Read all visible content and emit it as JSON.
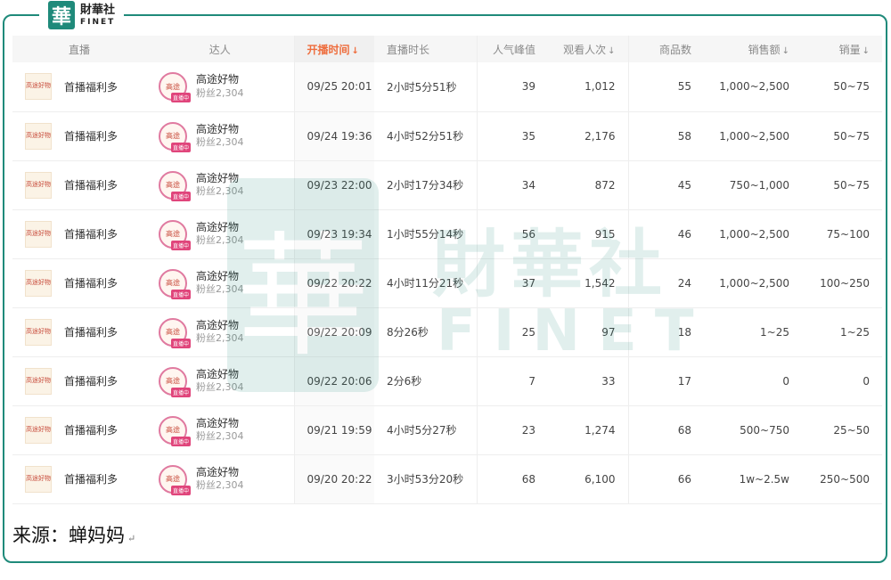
{
  "logo": {
    "mark": "華",
    "cn": "財華社",
    "en": "FINET"
  },
  "watermark": {
    "mark": "華",
    "cn": "財華社",
    "en": "FINET"
  },
  "table": {
    "headers": {
      "live": "直播",
      "talent": "达人",
      "start_time": "开播时间",
      "duration": "直播时长",
      "peak_popularity": "人气峰值",
      "views": "观看人次",
      "products": "商品数",
      "sales_amount": "销售额",
      "sales_volume": "销量"
    },
    "sort_arrow": "↓",
    "rows": [
      {
        "thumb": "高途好物",
        "title": "首播福利多",
        "avatar": "高途",
        "badge": "直播中",
        "name": "高途好物",
        "fans": "粉丝2,304",
        "start_time": "09/25 20:01",
        "duration": "2小时5分51秒",
        "peak": "39",
        "views": "1,012",
        "products": "55",
        "amount": "1,000~2,500",
        "volume": "50~75"
      },
      {
        "thumb": "高途好物",
        "title": "首播福利多",
        "avatar": "高途",
        "badge": "直播中",
        "name": "高途好物",
        "fans": "粉丝2,304",
        "start_time": "09/24 19:36",
        "duration": "4小时52分51秒",
        "peak": "35",
        "views": "2,176",
        "products": "58",
        "amount": "1,000~2,500",
        "volume": "50~75"
      },
      {
        "thumb": "高途好物",
        "title": "首播福利多",
        "avatar": "高途",
        "badge": "直播中",
        "name": "高途好物",
        "fans": "粉丝2,304",
        "start_time": "09/23 22:00",
        "duration": "2小时17分34秒",
        "peak": "34",
        "views": "872",
        "products": "45",
        "amount": "750~1,000",
        "volume": "50~75"
      },
      {
        "thumb": "高途好物",
        "title": "首播福利多",
        "avatar": "高途",
        "badge": "直播中",
        "name": "高途好物",
        "fans": "粉丝2,304",
        "start_time": "09/23 19:34",
        "duration": "1小时55分14秒",
        "peak": "56",
        "views": "915",
        "products": "46",
        "amount": "1,000~2,500",
        "volume": "75~100"
      },
      {
        "thumb": "高途好物",
        "title": "首播福利多",
        "avatar": "高途",
        "badge": "直播中",
        "name": "高途好物",
        "fans": "粉丝2,304",
        "start_time": "09/22 20:22",
        "duration": "4小时11分21秒",
        "peak": "37",
        "views": "1,542",
        "products": "24",
        "amount": "1,000~2,500",
        "volume": "100~250"
      },
      {
        "thumb": "高途好物",
        "title": "首播福利多",
        "avatar": "高途",
        "badge": "直播中",
        "name": "高途好物",
        "fans": "粉丝2,304",
        "start_time": "09/22 20:09",
        "duration": "8分26秒",
        "peak": "25",
        "views": "97",
        "products": "18",
        "amount": "1~25",
        "volume": "1~25"
      },
      {
        "thumb": "高途好物",
        "title": "首播福利多",
        "avatar": "高途",
        "badge": "直播中",
        "name": "高途好物",
        "fans": "粉丝2,304",
        "start_time": "09/22 20:06",
        "duration": "2分6秒",
        "peak": "7",
        "views": "33",
        "products": "17",
        "amount": "0",
        "volume": "0"
      },
      {
        "thumb": "高途好物",
        "title": "首播福利多",
        "avatar": "高途",
        "badge": "直播中",
        "name": "高途好物",
        "fans": "粉丝2,304",
        "start_time": "09/21 19:59",
        "duration": "4小时5分27秒",
        "peak": "23",
        "views": "1,274",
        "products": "68",
        "amount": "500~750",
        "volume": "25~50"
      },
      {
        "thumb": "高途好物",
        "title": "首播福利多",
        "avatar": "高途",
        "badge": "直播中",
        "name": "高途好物",
        "fans": "粉丝2,304",
        "start_time": "09/20 20:22",
        "duration": "3小时53分20秒",
        "peak": "68",
        "views": "6,100",
        "products": "66",
        "amount": "1w~2.5w",
        "volume": "250~500"
      }
    ]
  },
  "source": {
    "label": "来源：",
    "name": "蝉妈妈",
    "mark": "↵"
  },
  "colors": {
    "accent": "#1f8a7a",
    "sort_active": "#ee6d3d",
    "avatar_ring": "#e07aa0"
  }
}
